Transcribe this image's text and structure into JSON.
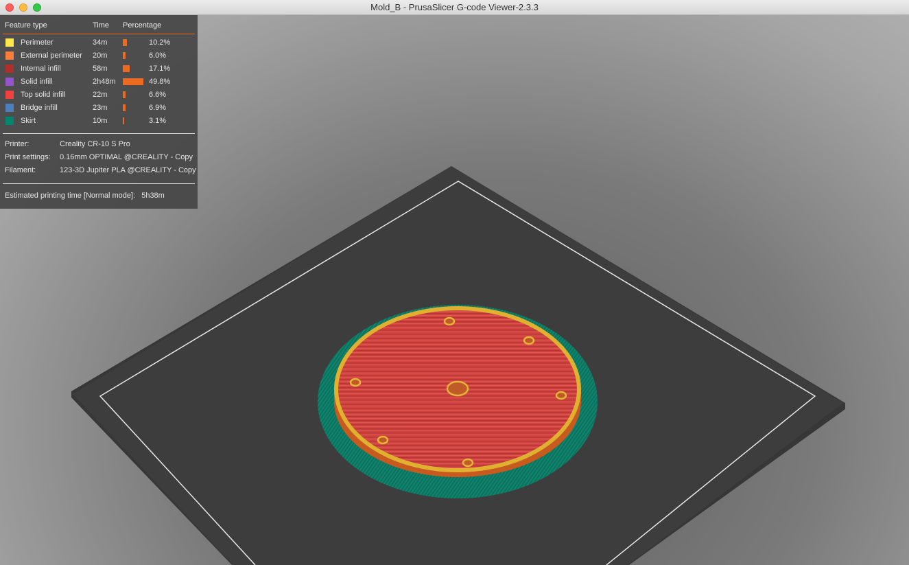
{
  "window": {
    "title": "Mold_B - PrusaSlicer G-code Viewer-2.3.3"
  },
  "legend": {
    "headers": {
      "feature": "Feature type",
      "time": "Time",
      "percentage": "Percentage"
    },
    "rows": [
      {
        "name": "Perimeter",
        "time": "34m",
        "percent": "10.2%",
        "value": 10.2,
        "color": "#ffe64d"
      },
      {
        "name": "External perimeter",
        "time": "20m",
        "percent": "6.0%",
        "value": 6.0,
        "color": "#ff7d38"
      },
      {
        "name": "Internal infill",
        "time": "58m",
        "percent": "17.1%",
        "value": 17.1,
        "color": "#b03029"
      },
      {
        "name": "Solid infill",
        "time": "2h48m",
        "percent": "49.8%",
        "value": 49.8,
        "color": "#9654cc"
      },
      {
        "name": "Top solid infill",
        "time": "22m",
        "percent": "6.6%",
        "value": 6.6,
        "color": "#f04040"
      },
      {
        "name": "Bridge infill",
        "time": "23m",
        "percent": "6.9%",
        "value": 6.9,
        "color": "#4d80ba"
      },
      {
        "name": "Skirt",
        "time": "10m",
        "percent": "3.1%",
        "value": 3.1,
        "color": "#00876e"
      }
    ],
    "printer_label": "Printer:",
    "printer_value": "Creality CR-10 S Pro",
    "print_settings_label": "Print settings:",
    "print_settings_value": "0.16mm OPTIMAL @CREALITY - Copy",
    "filament_label": "Filament:",
    "filament_value": "123-3D Jupiter PLA @CREALITY - Copy",
    "estimated_label": "Estimated printing time [Normal mode]:",
    "estimated_value": "5h38m"
  },
  "colors": {
    "accent": "#ed6b21",
    "bed": "#3a3a3a",
    "top_solid": "#d9403f",
    "perimeter_gold": "#e0b030",
    "skirt": "#0f8a72"
  }
}
